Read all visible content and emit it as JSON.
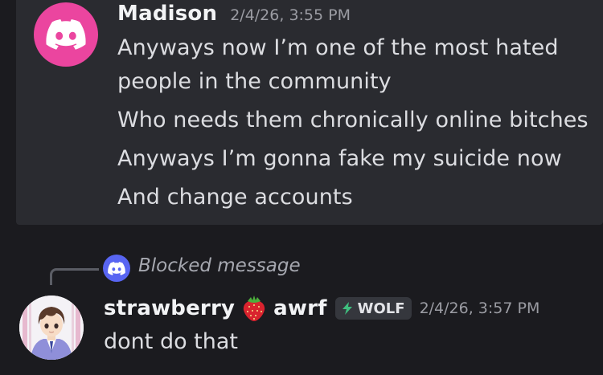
{
  "messages": {
    "first": {
      "author": "Madison",
      "timestamp": "2/4/26, 3:55 PM",
      "avatar_icon": "discord-logo-icon",
      "avatar_color": "#eb459f",
      "lines": [
        "Anyways now I’m one of the most hated",
        "people in the community",
        "Who needs them chronically online bitches",
        "Anyways I’m gonna fake my suicide now",
        "And change accounts"
      ]
    },
    "second": {
      "reply_text": "Blocked message",
      "reply_icon": "discord-logo-icon",
      "reply_icon_color": "#5865f2",
      "author": "strawberry",
      "emoji": "strawberry-icon",
      "author_suffix": "awrf",
      "tag": "WOLF",
      "tag_icon": "lightning-icon",
      "timestamp": "2/4/26, 3:57 PM",
      "content": "dont do that"
    }
  },
  "colors": {
    "background": "#1b1b1f",
    "highlight": "#2a2b30",
    "accent_blurple": "#5865f2"
  }
}
